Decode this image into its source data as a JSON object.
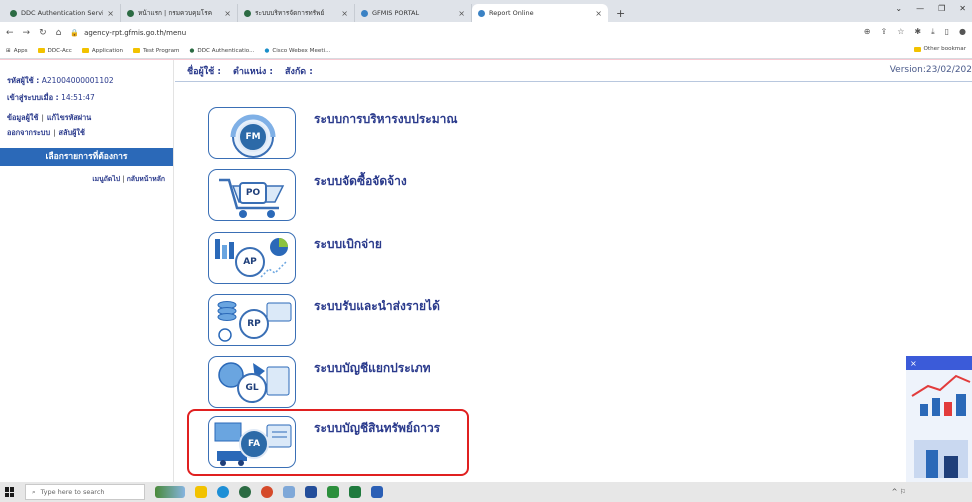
{
  "browser": {
    "tabs": [
      {
        "label": "DDC Authentication Services",
        "active": false
      },
      {
        "label": "หน้าแรก | กรมควบคุมโรค",
        "active": false
      },
      {
        "label": "ระบบบริหารจัดการทรัพย์",
        "active": false
      },
      {
        "label": "GFMIS PORTAL",
        "active": false
      },
      {
        "label": "Report Online",
        "active": true
      }
    ],
    "new_tab": "+",
    "url": "agency-rpt.gfmis.go.th/menu",
    "bookmarks": [
      "Apps",
      "DDC-Acc",
      "Application",
      "Test Program",
      "DDC Authenticatio...",
      "Cisco Webex Meeti..."
    ],
    "other_bookmarks": "Other bookmar"
  },
  "sidebar": {
    "user_id_label": "รหัสผู้ใช้ :",
    "user_id_value": "A21004000001102",
    "login_label": "เข้าสู่ระบบเมื่อ :",
    "login_value": "14:51:47",
    "link_user_info": "ข้อมูลผู้ใช้",
    "link_change_password": "แก้ไขรหัสผ่าน",
    "link_logout": "ออกจากระบบ",
    "link_switch_user": "สลับผู้ใช้",
    "choose_heading": "เลือกรายการที่ต้องการ",
    "link_general_menu": "เมนูถัดไป",
    "link_main_menu": "กลับหน้าหลัก"
  },
  "topbar": {
    "username_label": "ชื่อผู้ใช้ :",
    "position_label": "ตำแหน่ง :",
    "affiliation_label": "สังกัด :",
    "version": "Version:23/02/202"
  },
  "menu": [
    {
      "code": "FM",
      "label": "ระบบการบริหารงบประมาณ"
    },
    {
      "code": "PO",
      "label": "ระบบจัดซื้อจัดจ้าง"
    },
    {
      "code": "AP",
      "label": "ระบบเบิกจ่าย"
    },
    {
      "code": "RP",
      "label": "ระบบรับและนำส่งรายได้"
    },
    {
      "code": "GL",
      "label": "ระบบบัญชีแยกประเภท"
    },
    {
      "code": "FA",
      "label": "ระบบบัญชีสินทรัพย์ถาวร"
    }
  ],
  "taskbar": {
    "search_placeholder": "Type here to search"
  },
  "colors": {
    "accent": "#2b69b8",
    "text_blue": "#2a3a8c",
    "highlight": "#e02020",
    "page_frame": "#f7c9d2"
  }
}
